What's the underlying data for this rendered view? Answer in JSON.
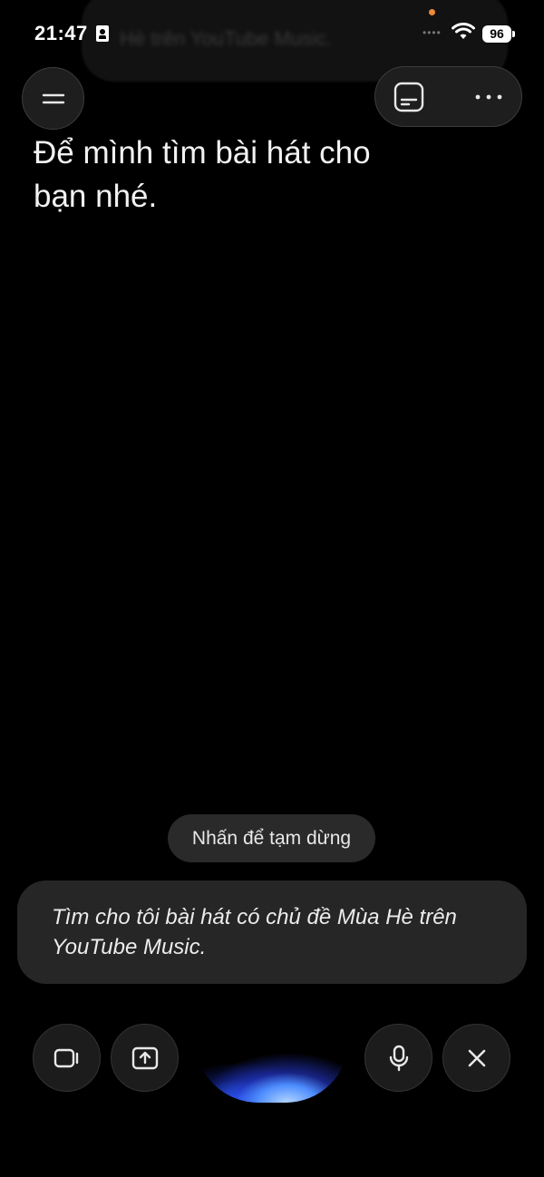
{
  "status_bar": {
    "time": "21:47",
    "battery": "96",
    "signal_dots": "••••"
  },
  "background_notification": {
    "text": "Hè trên YouTube Music."
  },
  "header": {
    "menu_icon": "menu-icon",
    "caption_icon": "caption-icon",
    "more_icon": "more-horizontal-icon"
  },
  "assistant_response": {
    "text": "Để mình tìm bài hát cho bạn nhé."
  },
  "pause_chip": {
    "label": "Nhấn để tạm dừng"
  },
  "transcript": {
    "text": "Tìm cho tôi bài hát có chủ đề Mùa Hè trên YouTube Music."
  },
  "controls": {
    "camera_icon": "video-camera-icon",
    "share_screen_icon": "share-screen-icon",
    "mic_icon": "microphone-icon",
    "close_icon": "close-icon"
  },
  "colors": {
    "background": "#000000",
    "chip": "#2a2a2a",
    "bubble": "#262626",
    "orb_blue": "#4d8dff",
    "notification_dot": "#f08a35"
  }
}
